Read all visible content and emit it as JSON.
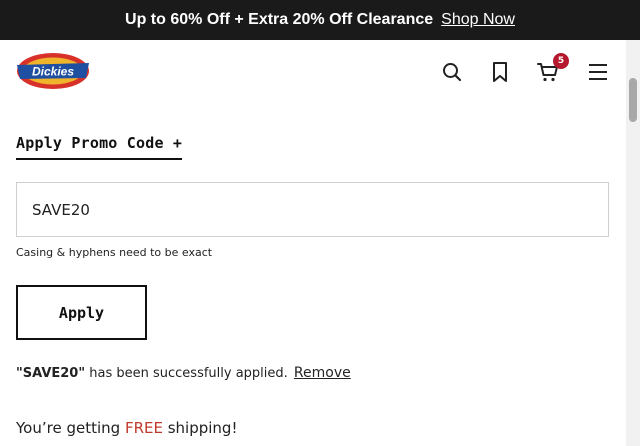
{
  "promo_bar": {
    "message": "Up to 60% Off + Extra 20% Off Clearance",
    "link_label": "Shop Now"
  },
  "header": {
    "logo_text": "Dickies",
    "logo_icon": "dickies-logo",
    "icons": [
      "search-icon",
      "bookmark-icon",
      "cart-icon",
      "menu-icon"
    ],
    "cart_count": "5",
    "colors": {
      "badge": "#b5172c",
      "logo_red": "#d8312a",
      "logo_blue": "#1f4fa0"
    }
  },
  "promo": {
    "toggle_label": "Apply Promo Code +",
    "input_value": "SAVE20",
    "hint": "Casing & hyphens need to be exact",
    "apply_label": "Apply",
    "success_code": "\"SAVE20\"",
    "success_text": " has been successfully applied.",
    "remove_label": "Remove"
  },
  "shipping": {
    "prefix": "You’re getting ",
    "free": "FREE",
    "suffix": " shipping!",
    "free_color": "#c0392b"
  }
}
